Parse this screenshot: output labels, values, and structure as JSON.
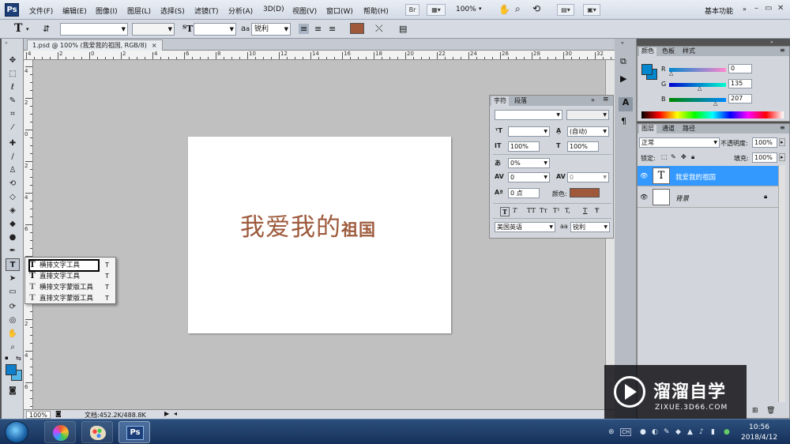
{
  "app": {
    "logo": "Ps"
  },
  "menu": {
    "items": [
      "文件(F)",
      "编辑(E)",
      "图像(I)",
      "图层(L)",
      "选择(S)",
      "滤镜(T)",
      "分析(A)",
      "3D(D)",
      "视图(V)",
      "窗口(W)",
      "帮助(H)"
    ],
    "zoom": "100%",
    "workspace": "基本功能",
    "bridge_label": "Br"
  },
  "options": {
    "tool_icon": "T",
    "aa_label": "a",
    "aa_sub": "a",
    "anti_alias": "锐利",
    "text_color": "#a0583b"
  },
  "document": {
    "tab_title": "1.psd @ 100% (我爱我的祖国, RGB/8)",
    "tab_close": "×",
    "text_large": "我爱我的",
    "text_small": "祖国",
    "text_color": "#9d5a3c",
    "status_zoom": "100%",
    "doc_size": "文档:452.2K/488.8K"
  },
  "rulers": {
    "top": [
      "4",
      "2",
      "0",
      "2",
      "4",
      "6",
      "8",
      "10",
      "12",
      "14",
      "16",
      "18",
      "20",
      "22",
      "24",
      "26",
      "28",
      "30",
      "32"
    ],
    "left": [
      "4",
      "2",
      "0",
      "2",
      "4",
      "6",
      "8",
      "1",
      "2",
      "4",
      "6"
    ]
  },
  "tool_flyout": {
    "items": [
      {
        "label": "横排文字工具",
        "key": "T",
        "icon": "T"
      },
      {
        "label": "直排文字工具",
        "key": "T",
        "icon": "T"
      },
      {
        "label": "横排文字蒙版工具",
        "key": "T",
        "icon": "T"
      },
      {
        "label": "直排文字蒙版工具",
        "key": "T",
        "icon": "T"
      }
    ]
  },
  "character_panel": {
    "tabs": [
      "字符",
      "段落"
    ],
    "menu_icon": "≡",
    "font_size": "",
    "leading": "(自动)",
    "vertical_scale": "100%",
    "horizontal_scale": "100%",
    "tsume": "0%",
    "kerning": "0",
    "tracking": "0",
    "baseline_shift": "0 点",
    "color_label": "颜色:",
    "color": "#a0583b",
    "format_buttons": [
      "T",
      "T",
      "TT",
      "Tт",
      "T¹",
      "T,",
      "T",
      "Ŧ"
    ],
    "language": "美国英语",
    "aa_label": "a",
    "aa_sub": "a",
    "anti_alias": "锐利"
  },
  "color_panel": {
    "tabs": [
      "颜色",
      "色板",
      "样式"
    ],
    "r_label": "R",
    "g_label": "G",
    "b_label": "B",
    "r": "0",
    "g": "135",
    "b": "207",
    "fg_color": "#0087cf"
  },
  "layers_panel": {
    "tabs": [
      "图层",
      "通道",
      "路径"
    ],
    "blend_mode": "正常",
    "opacity_label": "不透明度:",
    "opacity": "100%",
    "lock_label": "锁定:",
    "fill_label": "填充:",
    "fill": "100%",
    "layers": [
      {
        "name": "我爱我的祖国",
        "thumb": "T",
        "selected": true
      },
      {
        "name": "背景",
        "thumb": "",
        "selected": false
      }
    ]
  },
  "watermark": {
    "name": "溜溜自学",
    "url": "ZIXUE.3D66.COM"
  },
  "taskbar": {
    "ps_label": "Ps",
    "time": "10:56",
    "date": "2018/4/12",
    "tray": [
      "CH"
    ]
  }
}
